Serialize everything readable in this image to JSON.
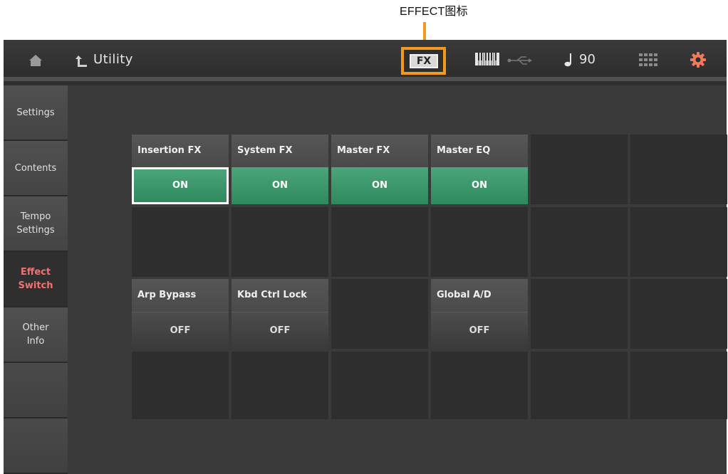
{
  "callout": {
    "label": "EFFECT图标"
  },
  "header": {
    "title": "Utility",
    "fx_label": "FX",
    "tempo": "90",
    "icons": [
      "home-icon",
      "back-icon",
      "keyboard-icon",
      "usb-icon",
      "note-icon",
      "grid-icon",
      "gear-icon"
    ]
  },
  "sidebar": {
    "items": [
      {
        "label": "Settings",
        "active": false
      },
      {
        "label": "Contents",
        "active": false
      },
      {
        "label": "Tempo\nSettings",
        "active": false
      },
      {
        "label": "Effect\nSwitch",
        "active": true
      },
      {
        "label": "Other\nInfo",
        "active": false
      }
    ]
  },
  "switches": {
    "insertion_fx": {
      "label": "Insertion FX",
      "value": "ON"
    },
    "system_fx": {
      "label": "System FX",
      "value": "ON"
    },
    "master_fx": {
      "label": "Master FX",
      "value": "ON"
    },
    "master_eq": {
      "label": "Master EQ",
      "value": "ON"
    },
    "arp_bypass": {
      "label": "Arp Bypass",
      "value": "OFF"
    },
    "kbd_ctrl_lock": {
      "label": "Kbd Ctrl Lock",
      "value": "OFF"
    },
    "global_ad": {
      "label": "Global A/D",
      "value": "OFF"
    }
  },
  "colors": {
    "accent_highlight": "#f29a1a",
    "on_green": "#3a9a6b",
    "active_tab_text": "#f07373"
  }
}
